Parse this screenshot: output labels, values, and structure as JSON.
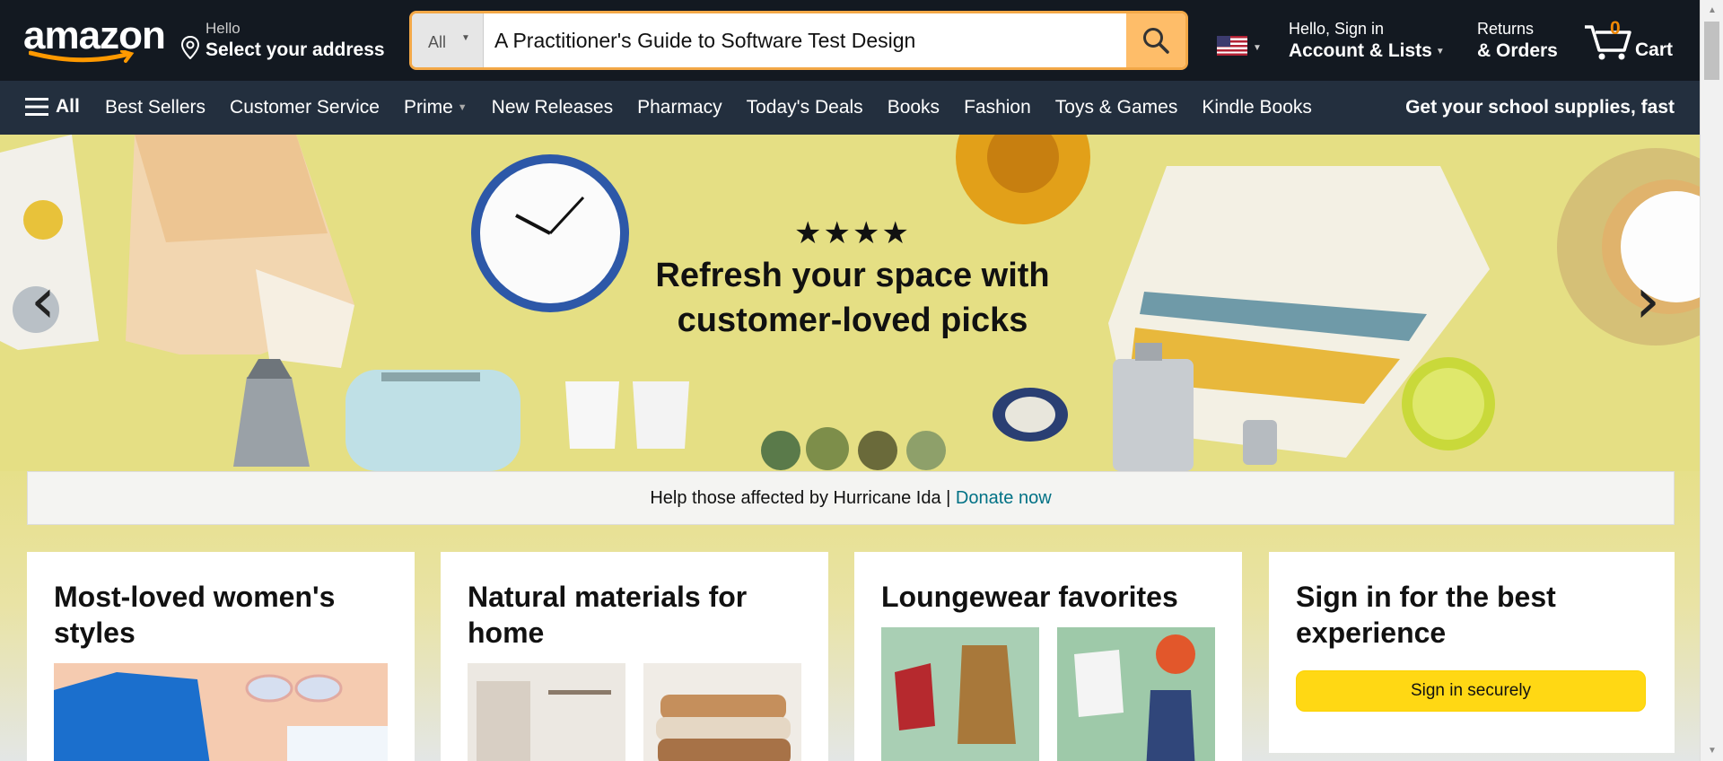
{
  "header": {
    "logo_text": "amazon",
    "address_hello": "Hello",
    "address_label": "Select your address",
    "search_category": "All",
    "search_value": "A Practitioner's Guide to Software Test Design",
    "account_line1": "Hello, Sign in",
    "account_line2": "Account & Lists",
    "returns_line1": "Returns",
    "returns_line2": "& Orders",
    "cart_count": "0",
    "cart_label": "Cart"
  },
  "nav": {
    "all_label": "All",
    "links": [
      "Best Sellers",
      "Customer Service",
      "Prime",
      "New Releases",
      "Pharmacy",
      "Today's Deals",
      "Books",
      "Fashion",
      "Toys & Games",
      "Kindle Books"
    ],
    "promo": "Get your school supplies, fast"
  },
  "hero": {
    "stars": "★★★★",
    "headline_line1": "Refresh your space with",
    "headline_line2": "customer-loved picks"
  },
  "donate": {
    "text": "Help those affected by Hurricane Ida | ",
    "link": "Donate now"
  },
  "cards": [
    {
      "title": "Most-loved women's styles"
    },
    {
      "title": "Natural materials for home"
    },
    {
      "title": "Loungewear favorites"
    },
    {
      "title": "Sign in for the best experience",
      "button": "Sign in securely"
    }
  ],
  "colors": {
    "nav_top": "#131921",
    "nav_main": "#232f3e",
    "search_button": "#febd69",
    "cart_count": "#f08804",
    "hero_bg": "#e5df84",
    "signin_button": "#ffd814",
    "link": "#007185"
  }
}
